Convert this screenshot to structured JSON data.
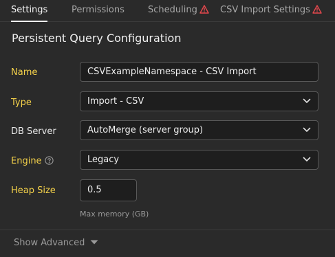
{
  "tabs": [
    {
      "label": "Settings",
      "active": true,
      "warning": false
    },
    {
      "label": "Permissions",
      "active": false,
      "warning": false
    },
    {
      "label": "Scheduling",
      "active": false,
      "warning": true
    },
    {
      "label": "CSV Import Settings",
      "active": false,
      "warning": true
    }
  ],
  "section_title": "Persistent Query Configuration",
  "fields": {
    "name": {
      "label": "Name",
      "value": "CSVExampleNamespace - CSV Import"
    },
    "type": {
      "label": "Type",
      "value": "Import - CSV"
    },
    "db_server": {
      "label": "DB Server",
      "value": "AutoMerge (server group)"
    },
    "engine": {
      "label": "Engine",
      "value": "Legacy"
    },
    "heap_size": {
      "label": "Heap Size",
      "value": "0.5",
      "hint": "Max memory (GB)"
    }
  },
  "show_advanced": "Show Advanced",
  "colors": {
    "background": "#2a2a2a",
    "required_label": "#f5d24a",
    "warning": "#e5484d",
    "input_bg": "#1e1e1e"
  },
  "icons": {
    "warning": "warning-triangle-icon",
    "help": "question-circle-icon",
    "dropdown": "chevron-down-icon"
  }
}
